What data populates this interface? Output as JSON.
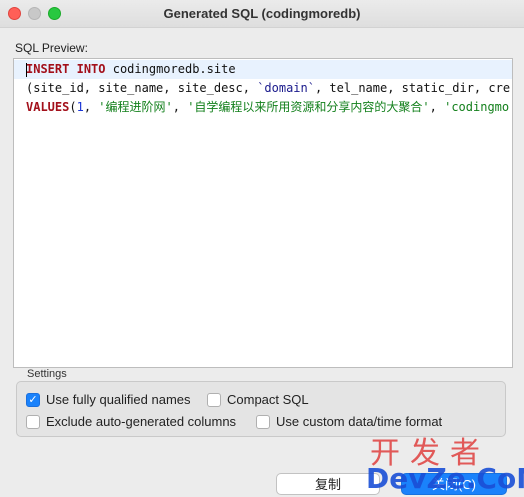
{
  "window": {
    "title": "Generated SQL (codingmoredb)"
  },
  "preview": {
    "label": "SQL Preview:",
    "line1": {
      "kw1": "INSERT",
      "kw2": "INTO",
      "rest": "codingmoredb.site"
    },
    "line2": {
      "a": "(site_id, site_name, site_desc, ",
      "ident": "`domain`",
      "b": ", tel_name, static_dir, cre"
    },
    "line3": {
      "kw": "VALUES",
      "open": "(",
      "num": "1",
      "sep1": ", ",
      "s1": "'编程进阶网'",
      "sep2": ", ",
      "s2": "'自学编程以来所用资源和分享内容的大聚合'",
      "sep3": ", ",
      "s3": "'codingmo"
    }
  },
  "settings": {
    "label": "Settings",
    "options": [
      {
        "label": "Use fully qualified names",
        "checked": true
      },
      {
        "label": "Compact SQL",
        "checked": false
      },
      {
        "label": "Exclude auto-generated columns",
        "checked": false
      },
      {
        "label": "Use custom data/time format",
        "checked": false
      }
    ]
  },
  "buttons": {
    "copy": "复制",
    "close": "关闭(C)"
  },
  "watermark": {
    "top": "开发者",
    "bottom": "DevZe.CoM"
  },
  "colors": {
    "keyword": "#a3101b",
    "string": "#13801c",
    "number": "#1a35d6",
    "accent": "#1a82fb"
  }
}
